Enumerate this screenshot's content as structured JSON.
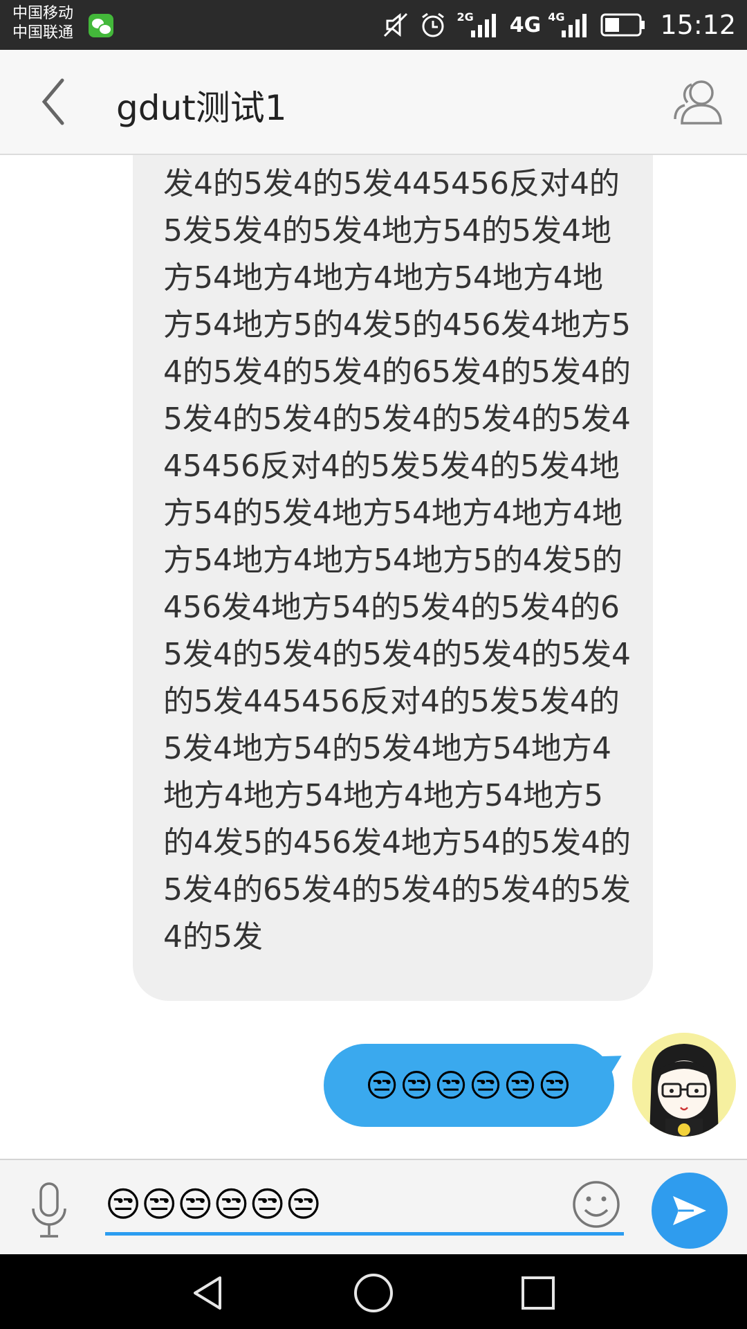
{
  "status_bar": {
    "carrier_1": "中国移动",
    "carrier_2": "中国联通",
    "network_1": "2G",
    "network_2_large": "4G",
    "network_2_small": "4G",
    "time": "15:12",
    "icons": [
      "wechat-icon",
      "mute-icon",
      "alarm-icon",
      "signal-icon",
      "data-arrows-icon",
      "battery-icon"
    ],
    "battery_level": 0.4
  },
  "header": {
    "title": "gdut测试1",
    "back_icon": "chevron-left-icon",
    "group_icon": "group-members-icon"
  },
  "messages": [
    {
      "direction": "incoming",
      "text": "发4的5发4的5发445456反对4的5发5发4的5发4地方54的5发4地方54地方4地方4地方54地方4地方54地方5的4发5的456发4地方54的5发4的5发4的65发4的5发4的5发4的5发4的5发4的5发4的5发445456反对4的5发5发4的5发4地方54的5发4地方54地方4地方4地方54地方4地方54地方5的4发5的456发4地方54的5发4的5发4的65发4的5发4的5发4的5发4的5发4的5发445456反对4的5发5发4的5发4地方54的5发4地方54地方4地方4地方54地方4地方54地方5的4发5的456发4地方54的5发4的5发4的65发4的5发4的5发4的5发4的5发"
    },
    {
      "direction": "outgoing",
      "text": "😒😒😒😒😒😒"
    }
  ],
  "composer": {
    "input_value": "😒😒😒😒😒😒",
    "mic_icon": "microphone-icon",
    "emoji_icon": "smiley-icon",
    "send_icon": "send-icon",
    "accent_color": "#2b9cf0"
  },
  "nav_bar": {
    "icons": [
      "back-triangle-icon",
      "home-circle-icon",
      "recents-square-icon"
    ]
  },
  "colors": {
    "outgoing_bubble": "#3aa9ee",
    "incoming_bubble": "#efefef",
    "send_button": "#2f9cee"
  }
}
